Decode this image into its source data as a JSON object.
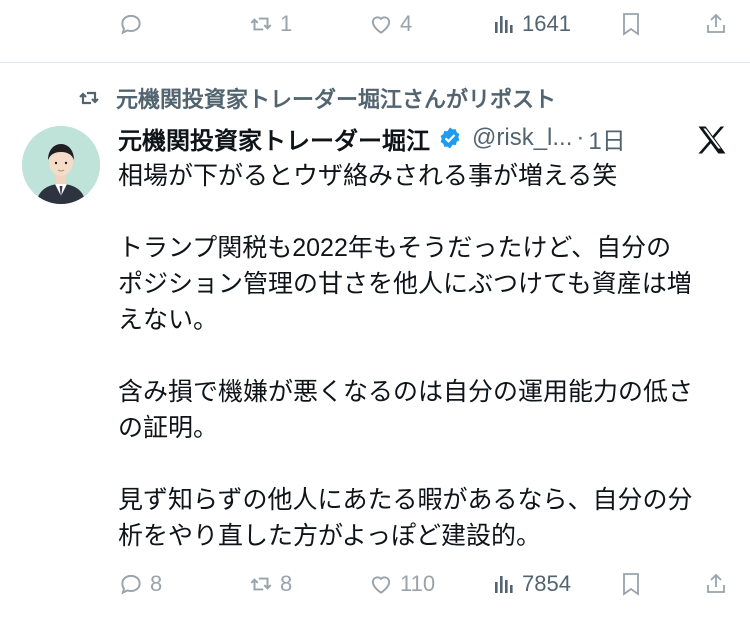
{
  "prev_tweet": {
    "actions": {
      "reply_count": "",
      "repost_count": "1",
      "like_count": "4",
      "view_count": "1641"
    }
  },
  "repost_header": {
    "text": "元機関投資家トレーダー堀江さんがリポスト"
  },
  "tweet": {
    "author_name": "元機関投資家トレーダー堀江",
    "handle": "@risk_l...",
    "dot": "·",
    "time": "1日",
    "lines": [
      "相場が下がるとウザ絡みされる事が増える笑",
      "",
      "トランプ関税も2022年もそうだったけど、自分の",
      "ポジション管理の甘さを他人にぶつけても資産は増",
      "えない。",
      "",
      "含み損で機嫌が悪くなるのは自分の運用能力の低さ",
      "の証明。",
      "",
      "見ず知らずの他人にあたる暇があるなら、自分の分",
      "析をやり直した方がよっぽど建設的。"
    ],
    "actions": {
      "reply_count": "8",
      "repost_count": "8",
      "like_count": "110",
      "view_count": "7854"
    }
  },
  "icons": {
    "reply": "reply-icon",
    "repost": "repost-icon",
    "like": "heart-icon",
    "views": "bar-chart-icon",
    "bookmark": "bookmark-icon",
    "share": "share-icon",
    "verified": "verified-badge-icon",
    "platform": "x-logo-icon"
  },
  "colors": {
    "text": "#0f1419",
    "muted": "#536471",
    "icon_muted": "#9aa3ab",
    "verified": "#1d9bf0",
    "divider": "#e1e8ed"
  }
}
